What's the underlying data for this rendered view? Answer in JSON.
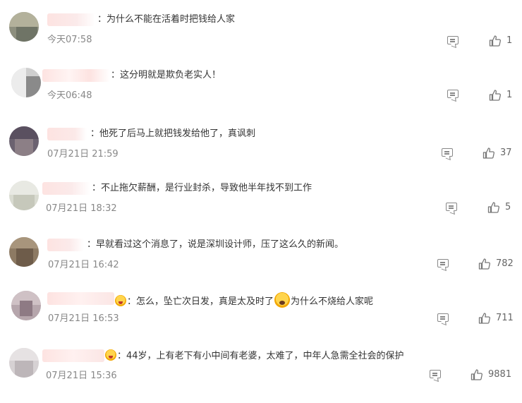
{
  "comments": [
    {
      "separator": "：",
      "text": "为什么不能在活着时把钱给人家",
      "time": "今天07:58",
      "likes": "1"
    },
    {
      "separator": "：",
      "text": "这分明就是欺负老实人！",
      "time": "今天06:48",
      "likes": "1"
    },
    {
      "separator": "：",
      "text": "他死了后马上就把钱发给他了，真讽刺",
      "time": "07月21日 21:59",
      "likes": "37"
    },
    {
      "separator": "：",
      "text": "不止拖欠薪酬，是行业封杀，导致他半年找不到工作",
      "time": "07月21日 18:32",
      "likes": "5"
    },
    {
      "separator": "：",
      "text": "早就看过这个消息了，说是深圳设计师，压了这么久的新闻。",
      "time": "07月21日 16:42",
      "likes": "782"
    },
    {
      "separator": "：",
      "text_a": "怎么，坠亡次日发，真是太及时了",
      "text_b": "为什么不烧给人家呢",
      "time": "07月21日 16:53",
      "likes": "711"
    },
    {
      "separator": "：",
      "text": "44岁，上有老下有小中间有老婆，太难了，中年人急需全社会的保护",
      "time": "07月21日 15:36",
      "likes": "9881"
    }
  ],
  "icons": {
    "comment": "comment-icon",
    "like": "thumbs-up-icon",
    "emoji": "emoji-icon"
  },
  "colors": {
    "text": "#333333",
    "time": "#888888",
    "username_blur": "#fde3e1"
  }
}
